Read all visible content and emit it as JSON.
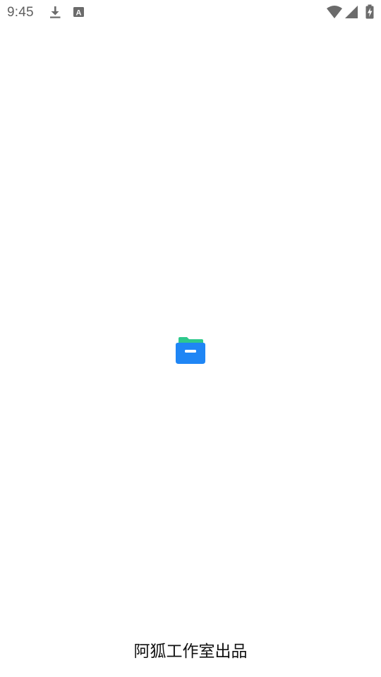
{
  "status_bar": {
    "time": "9:45",
    "left_icons": [
      "download-icon",
      "keyboard-a-icon"
    ],
    "right_icons": [
      "wifi-icon",
      "cellular-signal-icon",
      "battery-charging-icon"
    ]
  },
  "splash": {
    "logo_icon": "folder-icon",
    "colors": {
      "folder_back": "#2ec98c",
      "folder_front": "#1f86f5"
    }
  },
  "footer": {
    "credit": "阿狐工作室出品"
  }
}
